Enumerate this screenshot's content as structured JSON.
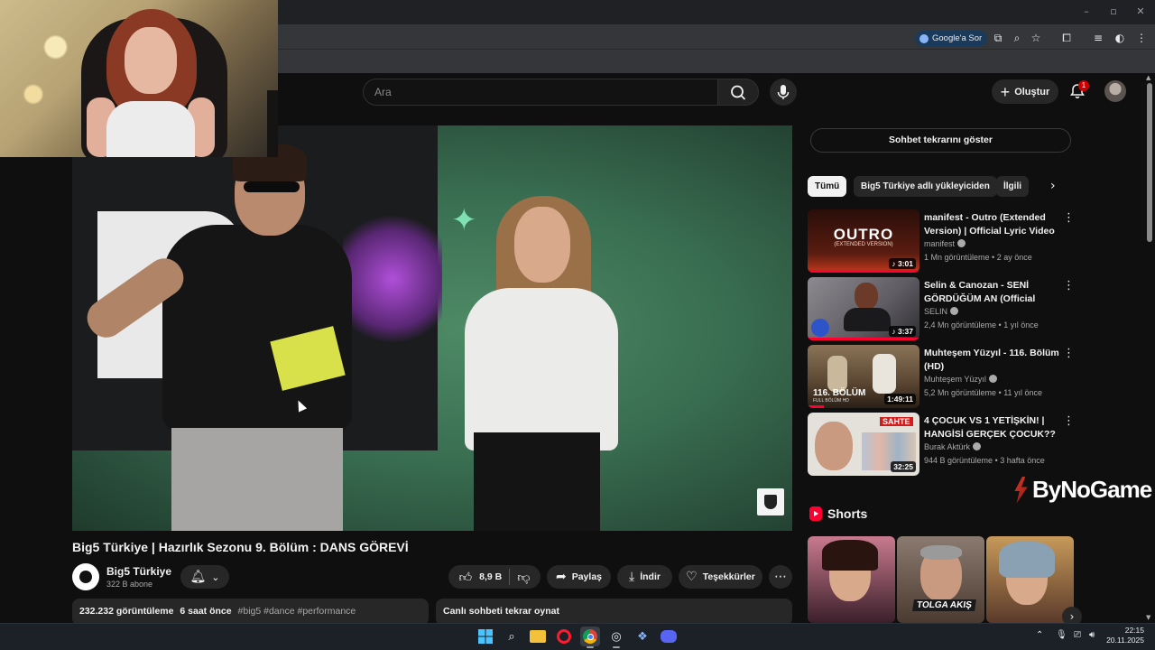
{
  "browser": {
    "minimize": "–",
    "restore": "▫",
    "close": "✕",
    "google_chip": "Google'a Sor"
  },
  "header": {
    "search_placeholder": "Ara",
    "create_label": "Oluştur",
    "notification_count": "1"
  },
  "video": {
    "title": "Big5 Türkiye | Hazırlık Sezonu 9. Bölüm : DANS GÖREVİ",
    "channel_name": "Big5 Türkiye",
    "subscribers": "322 B abone",
    "like_count": "8,9 B",
    "share_label": "Paylaş",
    "download_label": "İndir",
    "thanks_label": "Teşekkürler",
    "views": "232.232 görüntüleme",
    "posted": "6 saat önce",
    "hashtags": "#big5 #dance #performance",
    "chat_replay_label": "Canlı sohbeti tekrar oynat"
  },
  "sidebar": {
    "show_chat_label": "Sohbet tekrarını göster",
    "chips": [
      "Tümü",
      "Big5 Türkiye adlı yükleyiciden",
      "İlgili"
    ],
    "recommendations": [
      {
        "title": "manifest - Outro (Extended Version) | Official Lyric Video",
        "channel": "manifest",
        "views": "1 Mn görüntüleme",
        "age": "2 ay önce",
        "duration": "3:01",
        "thumb_text": "OUTRO",
        "thumb_sub": "(EXTENDED VERSION)",
        "thumb_color": "#3a1410"
      },
      {
        "title": "Selin & Canozan - SENİ GÖRDÜĞÜM AN (Official Musi...",
        "channel": "SELIN",
        "views": "2,4 Mn görüntüleme",
        "age": "1 yıl önce",
        "duration": "3:37",
        "thumb_color": "#6f6e73"
      },
      {
        "title": "Muhteşem Yüzyıl - 116. Bölüm (HD)",
        "channel": "Muhteşem Yüzyıl",
        "views": "5,2 Mn görüntüleme",
        "age": "11 yıl önce",
        "duration": "1:49:11",
        "thumb_text": "116. BÖLÜM",
        "thumb_sub": "FULL BÖLÜM HD",
        "thumb_color": "#5a4632"
      },
      {
        "title": "4 ÇOCUK VS 1 YETİŞKİN! | HANGİSİ GERÇEK ÇOCUK?? ...",
        "channel": "Burak Aktürk",
        "views": "944 B görüntüleme",
        "age": "3 hafta önce",
        "duration": "32:25",
        "thumb_text": "SAHTE",
        "thumb_color": "#d9d6cf"
      }
    ],
    "watermark": "ByNoGame",
    "shorts_title": "Shorts",
    "shorts": [
      {
        "caption": "",
        "color": "#3b1f2a"
      },
      {
        "caption": "TOLGA AKIŞ",
        "color": "#4a3a30"
      },
      {
        "caption": "",
        "color": "#5a3a2a"
      }
    ]
  },
  "taskbar": {
    "time": "22:15",
    "date": "20.11.2025"
  },
  "colors": {
    "background": "#0f0f0f",
    "youtube_red": "#ff0033",
    "chip_bg": "#272727"
  }
}
